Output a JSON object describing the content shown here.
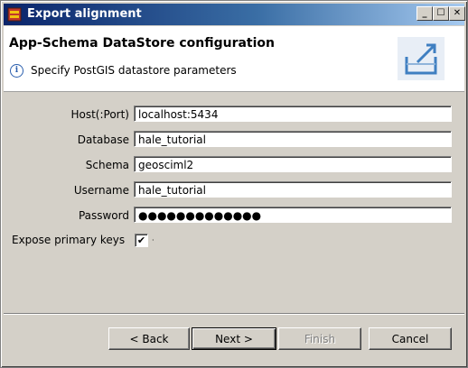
{
  "window": {
    "title": "Export alignment"
  },
  "titlebar": {
    "minimize": "_",
    "maximize": "☐",
    "close": "✕"
  },
  "header": {
    "title": "App-Schema DataStore configuration",
    "description": "Specify PostGIS datastore parameters"
  },
  "form": {
    "host_label": "Host(:Port)",
    "host_value": "localhost:5434",
    "database_label": "Database",
    "database_value": "hale_tutorial",
    "schema_label": "Schema",
    "schema_value": "geosciml2",
    "username_label": "Username",
    "username_value": "hale_tutorial",
    "password_label": "Password",
    "password_value": "●●●●●●●●●●●●●",
    "expose_label": "Expose primary keys",
    "expose_checked": "✔",
    "expose_extra": "·"
  },
  "buttons": {
    "back": "< Back",
    "next": "Next >",
    "finish": "Finish",
    "cancel": "Cancel"
  }
}
